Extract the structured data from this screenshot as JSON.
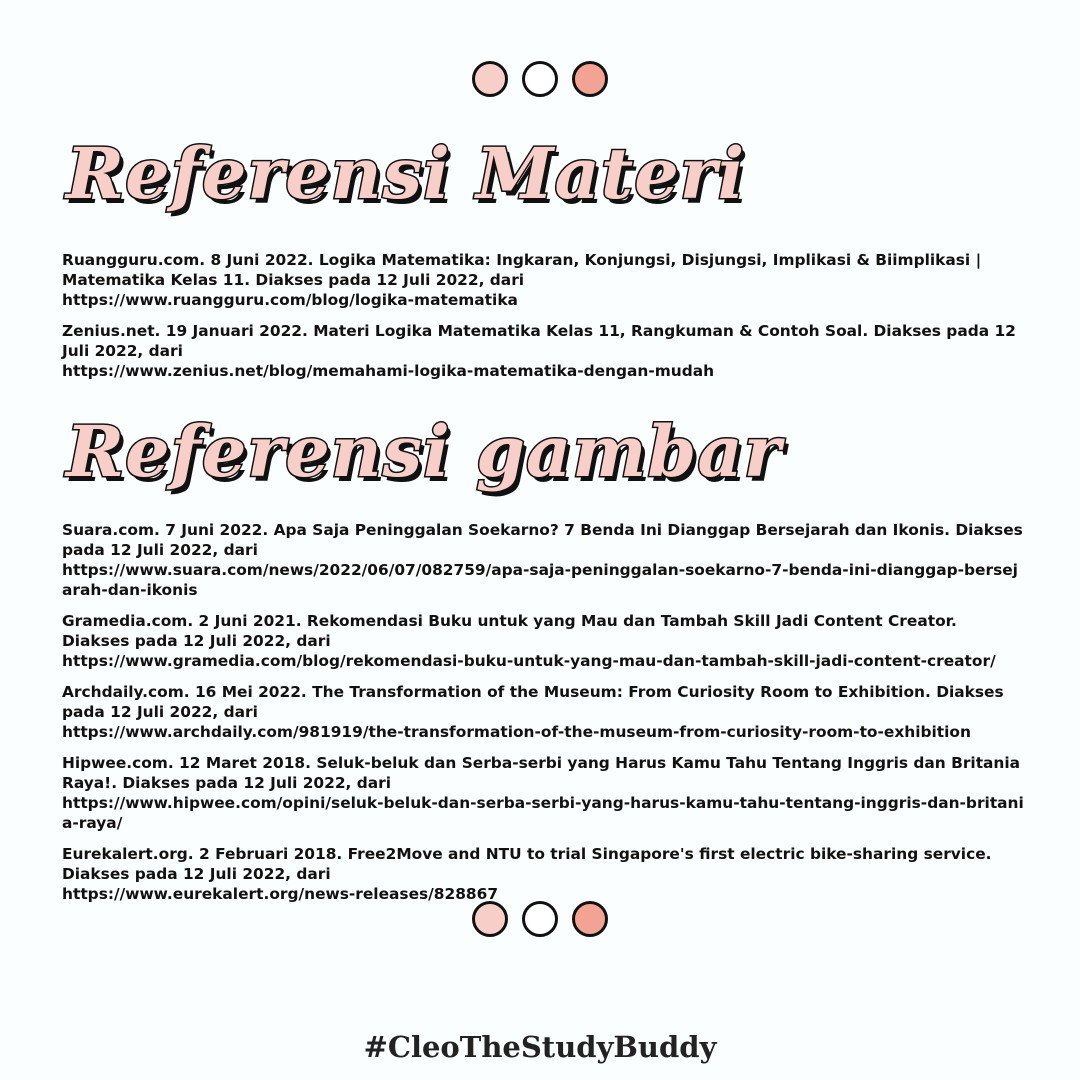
{
  "colors": {
    "dot_light": "#f7cfc8",
    "dot_empty": "#ffffff",
    "dot_accent": "#f2a393",
    "heading_fill": "#f7cfc8",
    "outline": "#111111"
  },
  "sections": [
    {
      "heading": "Referensi Materi",
      "refs": [
        {
          "citation": "Ruangguru.com. 8 Juni 2022. Logika Matematika: Ingkaran, Konjungsi, Disjungsi, Implikasi & Biimplikasi | Matematika Kelas 11. Diakses pada 12 Juli 2022, dari",
          "url": "https://www.ruangguru.com/blog/logika-matematika"
        },
        {
          "citation": "Zenius.net. 19 Januari 2022. Materi Logika Matematika Kelas 11, Rangkuman & Contoh Soal. Diakses pada 12 Juli 2022, dari",
          "url": "https://www.zenius.net/blog/memahami-logika-matematika-dengan-mudah"
        }
      ]
    },
    {
      "heading": "Referensi gambar",
      "refs": [
        {
          "citation": "Suara.com. 7 Juni 2022. Apa Saja Peninggalan Soekarno? 7 Benda Ini Dianggap Bersejarah dan Ikonis. Diakses pada 12 Juli 2022, dari",
          "url": "https://www.suara.com/news/2022/06/07/082759/apa-saja-peninggalan-soekarno-7-benda-ini-dianggap-bersejarah-dan-ikonis"
        },
        {
          "citation": "Gramedia.com. 2 Juni 2021. Rekomendasi Buku untuk yang Mau dan Tambah Skill Jadi Content Creator. Diakses pada 12 Juli 2022, dari",
          "url": "https://www.gramedia.com/blog/rekomendasi-buku-untuk-yang-mau-dan-tambah-skill-jadi-content-creator/"
        },
        {
          "citation": "Archdaily.com. 16 Mei 2022. The Transformation of the Museum: From Curiosity Room to Exhibition. Diakses pada 12 Juli 2022, dari",
          "url": "https://www.archdaily.com/981919/the-transformation-of-the-museum-from-curiosity-room-to-exhibition"
        },
        {
          "citation": "Hipwee.com. 12 Maret 2018. Seluk-beluk dan Serba-serbi yang Harus Kamu Tahu Tentang Inggris dan Britania Raya!. Diakses pada 12 Juli 2022, dari",
          "url": "https://www.hipwee.com/opini/seluk-beluk-dan-serba-serbi-yang-harus-kamu-tahu-tentang-inggris-dan-britania-raya/"
        },
        {
          "citation": "Eurekalert.org. 2 Februari 2018. Free2Move and NTU to trial Singapore's first electric bike-sharing service. Diakses pada 12 Juli 2022, dari",
          "url": "https://www.eurekalert.org/news-releases/828867"
        }
      ]
    }
  ],
  "footer": {
    "hashtag": "#CleoTheStudyBuddy"
  }
}
